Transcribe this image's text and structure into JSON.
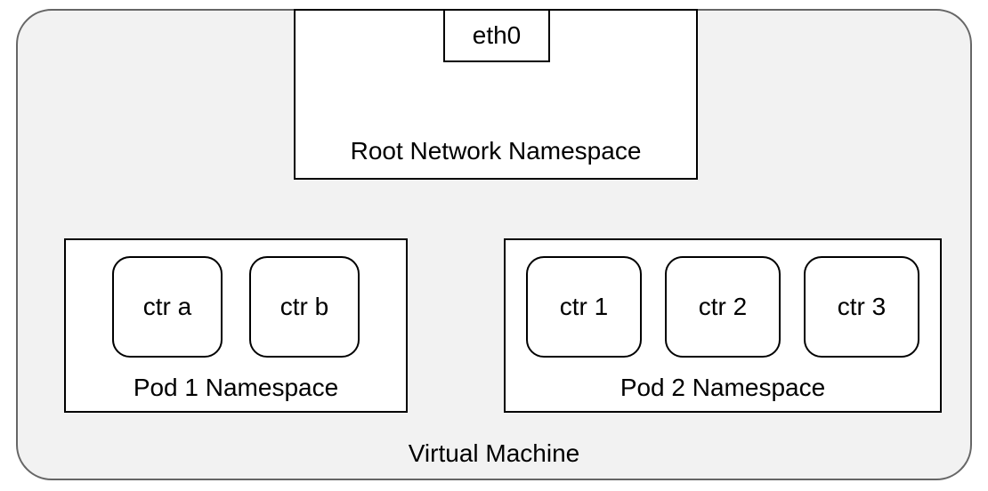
{
  "vm": {
    "label": "Virtual Machine"
  },
  "root_ns": {
    "label": "Root Network Namespace",
    "interface": "eth0"
  },
  "pod1": {
    "label": "Pod 1 Namespace",
    "containers": [
      "ctr a",
      "ctr b"
    ]
  },
  "pod2": {
    "label": "Pod 2 Namespace",
    "containers": [
      "ctr 1",
      "ctr 2",
      "ctr 3"
    ]
  }
}
